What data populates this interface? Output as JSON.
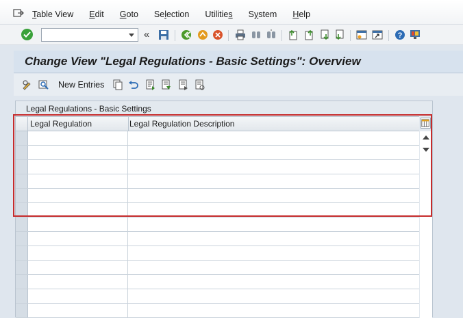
{
  "menu": {
    "items": [
      {
        "prefix": "",
        "underline": "T",
        "rest": "able View"
      },
      {
        "prefix": "",
        "underline": "E",
        "rest": "dit"
      },
      {
        "prefix": "",
        "underline": "G",
        "rest": "oto"
      },
      {
        "prefix": "Se",
        "underline": "l",
        "rest": "ection"
      },
      {
        "prefix": "Utilitie",
        "underline": "s",
        "rest": ""
      },
      {
        "prefix": "S",
        "underline": "y",
        "rest": "stem"
      },
      {
        "prefix": "",
        "underline": "H",
        "rest": "elp"
      }
    ]
  },
  "toolbar": {
    "command_field_value": "",
    "nav_back": "«"
  },
  "page": {
    "title": "Change View \"Legal Regulations - Basic Settings\": Overview"
  },
  "app_toolbar": {
    "new_entries_label": "New Entries"
  },
  "table": {
    "title": "Legal Regulations - Basic Settings",
    "columns": [
      "Legal Regulation",
      "Legal Regulation Description"
    ],
    "rows": [
      [
        "",
        ""
      ],
      [
        "",
        ""
      ],
      [
        "",
        ""
      ],
      [
        "",
        ""
      ],
      [
        "",
        ""
      ],
      [
        "",
        ""
      ],
      [
        "",
        ""
      ],
      [
        "",
        ""
      ],
      [
        "",
        ""
      ],
      [
        "",
        ""
      ],
      [
        "",
        ""
      ],
      [
        "",
        ""
      ],
      [
        "",
        ""
      ]
    ]
  },
  "colors": {
    "highlight": "#c62b2b",
    "title_bar": "#d7e2ee",
    "ok_green": "#3aa13a"
  }
}
